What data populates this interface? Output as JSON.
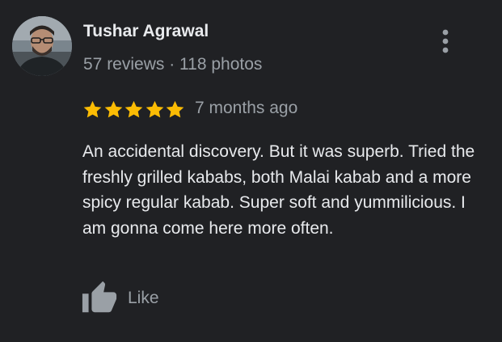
{
  "reviewer": {
    "name": "Tushar Agrawal",
    "stats": "57 reviews · 118 photos",
    "avatar_icon": "user-avatar-photo"
  },
  "rating": {
    "stars": 5,
    "max_stars": 5,
    "star_color": "#fbbc04",
    "time_ago": "7 months ago"
  },
  "review": {
    "text": "An accidental discovery. But it was superb. Tried the freshly grilled kababs, both Malai kabab and a more spicy regular kabab. Super soft and yummilicious. I am gonna come here more often."
  },
  "actions": {
    "like_label": "Like",
    "like_icon": "thumbs-up-icon",
    "more_icon": "more-vert-icon"
  },
  "colors": {
    "background": "#202124",
    "primary_text": "#e8eaed",
    "secondary_text": "#9aa0a6"
  }
}
